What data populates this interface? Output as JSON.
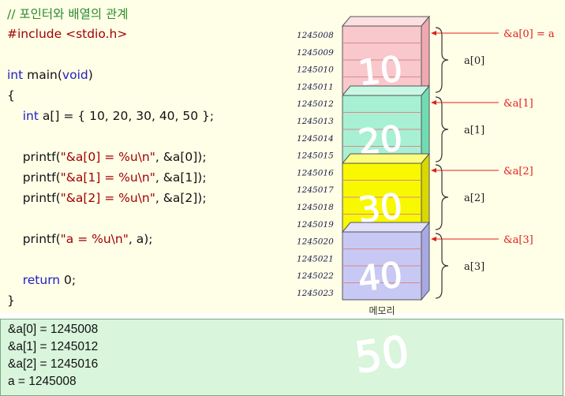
{
  "code": {
    "lines": [
      [
        {
          "t": "// 포인터와 배열의 관계",
          "c": "comment"
        }
      ],
      [
        {
          "t": "#include ",
          "c": "pp"
        },
        {
          "t": "<stdio.h>",
          "c": "str"
        }
      ],
      [],
      [
        {
          "t": "int ",
          "c": "kw"
        },
        {
          "t": "main(",
          "c": "plain"
        },
        {
          "t": "void",
          "c": "kw"
        },
        {
          "t": ")",
          "c": "plain"
        }
      ],
      [
        {
          "t": "{",
          "c": "plain"
        }
      ],
      [
        {
          "t": "    ",
          "c": "plain"
        },
        {
          "t": "int ",
          "c": "kw"
        },
        {
          "t": "a[] = { 10, 20, 30, 40, 50 };",
          "c": "plain"
        }
      ],
      [],
      [
        {
          "t": "    printf(",
          "c": "plain"
        },
        {
          "t": "\"&a[0] = %u\\n\"",
          "c": "str"
        },
        {
          "t": ", &a[0]);",
          "c": "plain"
        }
      ],
      [
        {
          "t": "    printf(",
          "c": "plain"
        },
        {
          "t": "\"&a[1] = %u\\n\"",
          "c": "str"
        },
        {
          "t": ", &a[1]);",
          "c": "plain"
        }
      ],
      [
        {
          "t": "    printf(",
          "c": "plain"
        },
        {
          "t": "\"&a[2] = %u\\n\"",
          "c": "str"
        },
        {
          "t": ", &a[2]);",
          "c": "plain"
        }
      ],
      [],
      [
        {
          "t": "    printf(",
          "c": "plain"
        },
        {
          "t": "\"a = %u\\n\"",
          "c": "str"
        },
        {
          "t": ", a);",
          "c": "plain"
        }
      ],
      [],
      [
        {
          "t": "    ",
          "c": "plain"
        },
        {
          "t": "return ",
          "c": "kw"
        },
        {
          "t": "0;",
          "c": "plain"
        }
      ],
      [
        {
          "t": "}",
          "c": "plain"
        }
      ]
    ]
  },
  "output": {
    "lines": [
      "&a[0] = 1245008",
      "&a[1] = 1245012",
      "&a[2] = 1245016",
      "a = 1245008"
    ]
  },
  "memory": {
    "addresses": [
      "1245008",
      "1245009",
      "1245010",
      "1245011",
      "1245012",
      "1245013",
      "1245014",
      "1245015",
      "1245016",
      "1245017",
      "1245018",
      "1245019",
      "1245020",
      "1245021",
      "1245022",
      "1245023"
    ],
    "blocks": [
      {
        "color": "#f8c8cc",
        "side": "#f0a8b0",
        "top": "#fbe0e2",
        "value": "10",
        "element_label": "a[0]",
        "pointer_label": "&a[0] = a"
      },
      {
        "color": "#a8f0d4",
        "side": "#70dcb4",
        "top": "#c8f8e4",
        "value": "20",
        "element_label": "a[1]",
        "pointer_label": "&a[1]"
      },
      {
        "color": "#f8f800",
        "side": "#d8d800",
        "top": "#fcfc80",
        "value": "30",
        "element_label": "a[2]",
        "pointer_label": "&a[2]"
      },
      {
        "color": "#c8c8f4",
        "side": "#a8a8e4",
        "top": "#e0e0fa",
        "value": "40",
        "element_label": "a[3]",
        "pointer_label": "&a[3]"
      }
    ],
    "caption": "메모리"
  },
  "handwritten": {
    "extra_value": "50"
  },
  "colors": {
    "code_bg": "#ffffe8",
    "output_bg": "#d9f5dc",
    "pointer_arrow": "#e0201c"
  }
}
